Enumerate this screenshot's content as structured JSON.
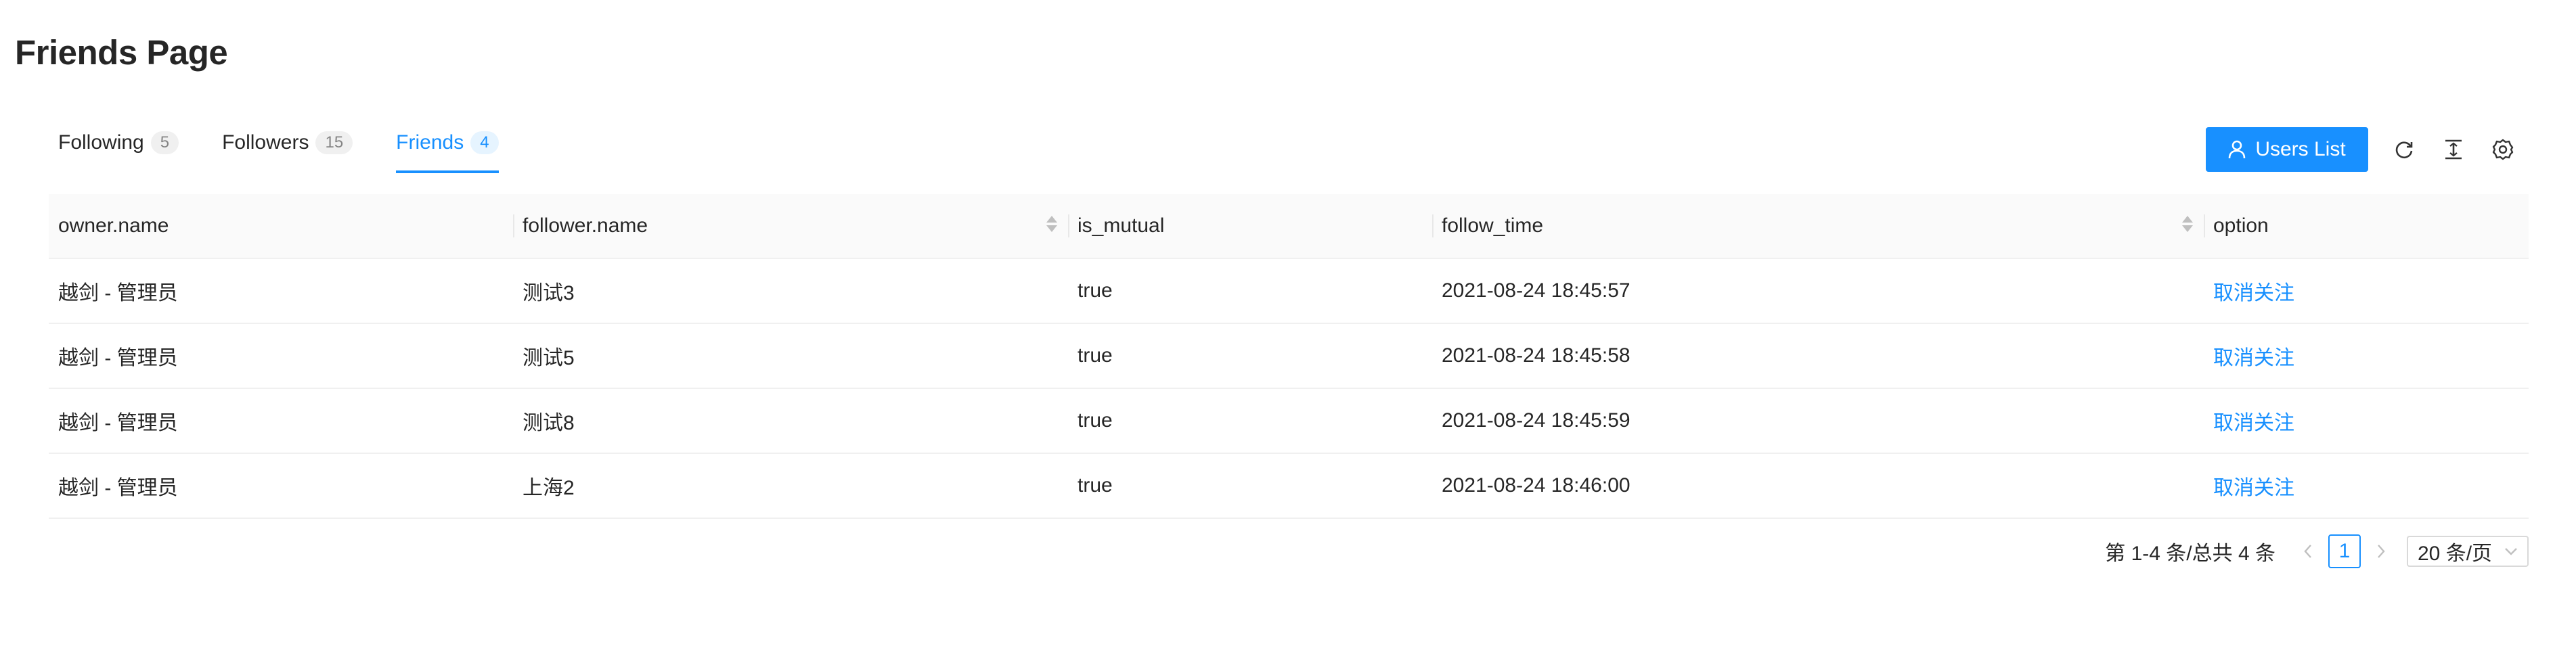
{
  "page": {
    "title": "Friends Page"
  },
  "tabs": [
    {
      "label": "Following",
      "count": "5"
    },
    {
      "label": "Followers",
      "count": "15"
    },
    {
      "label": "Friends",
      "count": "4"
    }
  ],
  "toolbar": {
    "users_list_label": "Users List",
    "icons": [
      "user-icon",
      "reload-icon",
      "column-height-icon",
      "setting-icon"
    ]
  },
  "table": {
    "columns": [
      "owner.name",
      "follower.name",
      "is_mutual",
      "follow_time",
      "option"
    ],
    "rows": [
      {
        "owner": "越剑 - 管理员",
        "follower": "测试3",
        "is_mutual": "true",
        "follow_time": "2021-08-24 18:45:57",
        "option": "取消关注"
      },
      {
        "owner": "越剑 - 管理员",
        "follower": "测试5",
        "is_mutual": "true",
        "follow_time": "2021-08-24 18:45:58",
        "option": "取消关注"
      },
      {
        "owner": "越剑 - 管理员",
        "follower": "测试8",
        "is_mutual": "true",
        "follow_time": "2021-08-24 18:45:59",
        "option": "取消关注"
      },
      {
        "owner": "越剑 - 管理员",
        "follower": "上海2",
        "is_mutual": "true",
        "follow_time": "2021-08-24 18:46:00",
        "option": "取消关注"
      }
    ]
  },
  "pagination": {
    "total_text": "第 1-4 条/总共 4 条",
    "current_page": "1",
    "page_size": "20 条/页"
  },
  "colors": {
    "primary": "#1890ff",
    "header_bg": "#fafafa",
    "border": "#f0f0f0"
  }
}
